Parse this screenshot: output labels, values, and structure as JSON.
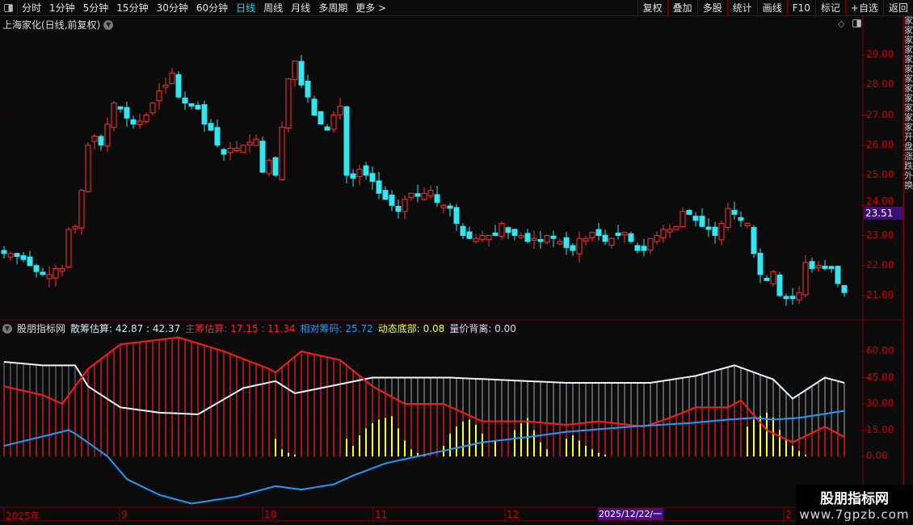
{
  "toolbar": {
    "periods": [
      "分时",
      "1分钟",
      "5分钟",
      "15分钟",
      "30分钟",
      "60分钟",
      "日线",
      "周线",
      "月线",
      "多周期",
      "更多 >"
    ],
    "active_period": "日线",
    "right_tools": [
      "复权",
      "叠加",
      "多股",
      "统计",
      "画线",
      "F10",
      "标记",
      "+自选",
      "返回"
    ]
  },
  "title": "上海家化(日线,前复权)",
  "price_axis": {
    "labels": [
      "29.00",
      "28.00",
      "27.00",
      "26.00",
      "25.00",
      "24.00",
      "23.00",
      "22.00",
      "21.00"
    ],
    "current_price": "23.51"
  },
  "indicator": {
    "name": "股朋指标网",
    "items": [
      {
        "label": "散筹估算: 42.87 : 42.37",
        "color": "#cfe8f5"
      },
      {
        "label": "主筹估算: 17.15 : 11.34",
        "color": "#ff2020"
      },
      {
        "label": "相对筹码: 25.72",
        "color": "#1e9bff"
      },
      {
        "label": "动态底部: 0.08",
        "color": "#ffff20"
      },
      {
        "label": "量价背离: 0.00",
        "color": "#e8d0f0"
      }
    ],
    "axis_labels": [
      "60.00",
      "45.00",
      "30.00",
      "15.00",
      "0.00"
    ]
  },
  "time_axis": {
    "labels": [
      "2025年",
      "9",
      "10",
      "11",
      "12",
      "2"
    ],
    "highlight": "2025/12/22/一"
  },
  "watermark": {
    "title": "股朋指标网",
    "url": "www.7gpzb.com"
  },
  "colors": {
    "up": "#ff3030",
    "down": "#33e6f0",
    "grid": "#7a0000",
    "axis_text": "#cc0000"
  },
  "chart_data": {
    "type": "candlestick",
    "closes": [
      22.4,
      22.4,
      22.3,
      22.2,
      22.0,
      21.8,
      21.7,
      21.7,
      21.9,
      21.9,
      23.2,
      23.3,
      24.5,
      26.0,
      26.3,
      26.0,
      26.7,
      27.4,
      27.2,
      26.9,
      26.7,
      26.8,
      27.0,
      27.4,
      27.8,
      28.0,
      28.4,
      27.6,
      27.4,
      27.3,
      27.2,
      26.7,
      26.5,
      26.0,
      25.7,
      25.9,
      25.9,
      26.0,
      26.1,
      26.2,
      25.1,
      25.5,
      25.0,
      26.6,
      28.2,
      28.8,
      28.0,
      27.6,
      27.0,
      26.7,
      26.5,
      27.0,
      27.3,
      25.0,
      24.9,
      25.2,
      25.0,
      24.8,
      24.4,
      24.2,
      24.0,
      23.8,
      24.2,
      24.4,
      24.3,
      24.4,
      24.5,
      24.1,
      24.0,
      23.9,
      23.4,
      23.0,
      22.9,
      22.9,
      23.0,
      23.0,
      23.0,
      23.4,
      23.1,
      23.0,
      23.0,
      22.8,
      22.9,
      22.8,
      23.0,
      22.9,
      22.8,
      22.6,
      22.5,
      22.9,
      22.9,
      23.1,
      23.0,
      22.8,
      22.9,
      23.0,
      23.1,
      22.8,
      22.5,
      22.5,
      22.9,
      23.0,
      23.2,
      23.2,
      23.3,
      23.8,
      23.7,
      23.5,
      23.3,
      23.2,
      23.0,
      23.4,
      23.9,
      23.7,
      23.5,
      23.4,
      22.4,
      21.7,
      21.5,
      21.8,
      21.0,
      20.9,
      20.9,
      21.1,
      22.1,
      21.9,
      22.0,
      21.9,
      21.9,
      21.4,
      21.1
    ],
    "ylim": [
      20.5,
      29.7
    ],
    "indicator_series": {
      "散筹估算": [
        [
          0,
          54
        ],
        [
          6,
          52
        ],
        [
          11,
          52
        ],
        [
          13,
          40
        ],
        [
          18,
          28
        ],
        [
          24,
          25
        ],
        [
          30,
          24
        ],
        [
          37,
          39
        ],
        [
          42,
          43
        ],
        [
          45,
          36
        ],
        [
          57,
          45
        ],
        [
          69,
          45
        ],
        [
          87,
          42
        ],
        [
          100,
          42
        ],
        [
          107,
          46
        ],
        [
          113,
          52
        ],
        [
          119,
          44
        ],
        [
          122,
          33
        ],
        [
          127,
          45
        ],
        [
          130,
          42
        ]
      ],
      "主筹估算": [
        [
          0,
          40
        ],
        [
          6,
          35
        ],
        [
          9,
          30
        ],
        [
          13,
          50
        ],
        [
          18,
          64
        ],
        [
          27,
          68
        ],
        [
          34,
          60
        ],
        [
          41,
          50
        ],
        [
          42,
          48
        ],
        [
          46,
          60
        ],
        [
          52,
          55
        ],
        [
          57,
          40
        ],
        [
          62,
          30
        ],
        [
          68,
          30
        ],
        [
          74,
          20
        ],
        [
          81,
          20
        ],
        [
          87,
          18
        ],
        [
          92,
          20
        ],
        [
          99,
          17
        ],
        [
          103,
          22
        ],
        [
          107,
          28
        ],
        [
          112,
          28
        ],
        [
          114,
          32
        ],
        [
          118,
          15
        ],
        [
          122,
          8
        ],
        [
          127,
          17
        ],
        [
          130,
          11
        ]
      ],
      "相对筹码": [
        [
          0,
          6
        ],
        [
          10,
          15
        ],
        [
          11,
          13
        ],
        [
          16,
          0
        ],
        [
          19,
          -13
        ],
        [
          24,
          -22
        ],
        [
          29,
          -27
        ],
        [
          36,
          -23
        ],
        [
          42,
          -17
        ],
        [
          46,
          -19
        ],
        [
          51,
          -16
        ],
        [
          54,
          -11
        ],
        [
          59,
          -4
        ],
        [
          64,
          0
        ],
        [
          69,
          4
        ],
        [
          74,
          8
        ],
        [
          81,
          11
        ],
        [
          87,
          14
        ],
        [
          97,
          17
        ],
        [
          106,
          19
        ],
        [
          112,
          21
        ],
        [
          116,
          22
        ],
        [
          119,
          21
        ],
        [
          123,
          22
        ],
        [
          130,
          26
        ]
      ],
      "动态底部": [
        [
          42,
          10
        ],
        [
          43,
          4
        ],
        [
          44,
          2
        ],
        [
          45,
          1
        ],
        [
          53,
          10
        ],
        [
          54,
          6
        ],
        [
          55,
          12
        ],
        [
          56,
          16
        ],
        [
          57,
          19
        ],
        [
          58,
          21
        ],
        [
          59,
          22
        ],
        [
          60,
          23
        ],
        [
          61,
          16
        ],
        [
          62,
          9
        ],
        [
          63,
          4
        ],
        [
          64,
          2
        ],
        [
          65,
          1
        ],
        [
          68,
          6
        ],
        [
          69,
          13
        ],
        [
          70,
          17
        ],
        [
          71,
          20
        ],
        [
          72,
          21
        ],
        [
          73,
          18
        ],
        [
          74,
          13
        ],
        [
          76,
          9
        ],
        [
          79,
          15
        ],
        [
          80,
          19
        ],
        [
          81,
          22
        ],
        [
          82,
          15
        ],
        [
          83,
          8
        ],
        [
          84,
          4
        ],
        [
          87,
          10
        ],
        [
          88,
          12
        ],
        [
          89,
          9
        ],
        [
          90,
          6
        ],
        [
          91,
          4
        ],
        [
          92,
          2
        ],
        [
          93,
          1
        ],
        [
          115,
          17
        ],
        [
          116,
          21
        ],
        [
          117,
          23
        ],
        [
          118,
          25
        ],
        [
          119,
          22
        ],
        [
          120,
          15
        ],
        [
          121,
          10
        ],
        [
          122,
          6
        ],
        [
          123,
          3
        ],
        [
          124,
          1
        ]
      ]
    },
    "indicator_ylim": [
      -30,
      70
    ]
  }
}
